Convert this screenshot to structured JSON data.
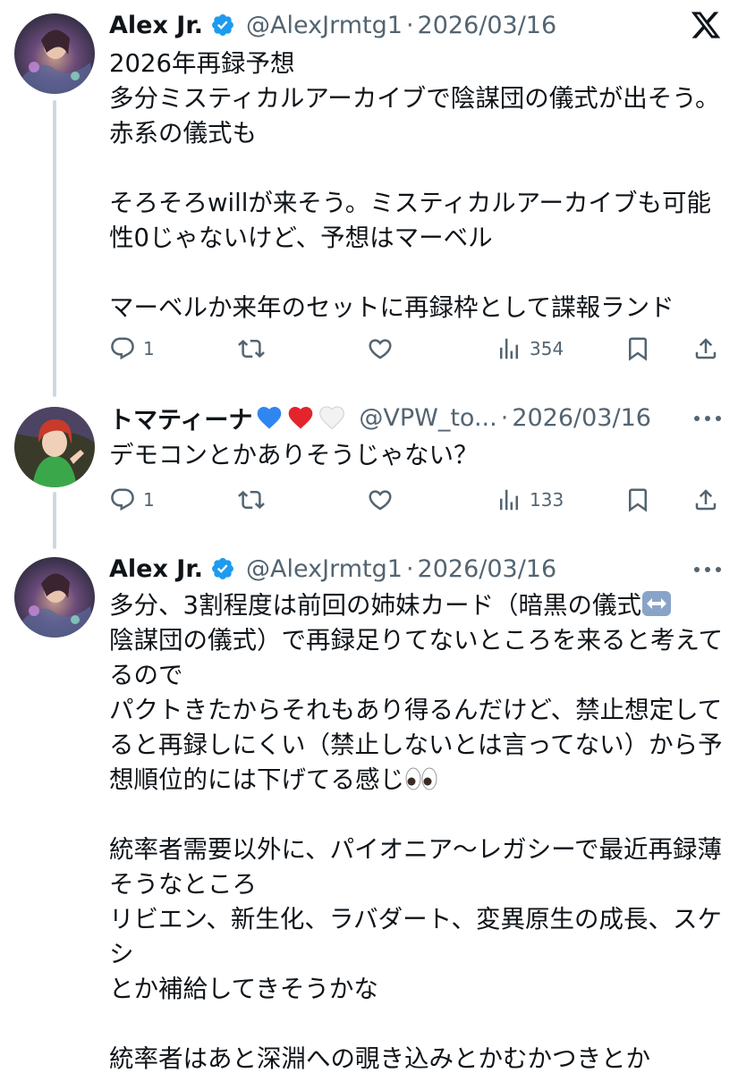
{
  "brand": {
    "logo_icon": "x-logo-icon"
  },
  "colors": {
    "verified": "#1d9bf0",
    "muted": "#536471",
    "thread_line": "#cfd9de",
    "text": "#0f1419"
  },
  "tweets": [
    {
      "author": {
        "name": "Alex Jr.",
        "handle": "@AlexJrmtg1",
        "verified": true
      },
      "date": "2026/03/16",
      "separator": "·",
      "text": "2026年再録予想\n多分ミスティカルアーカイブで陰謀団の儀式が出そう。赤系の儀式も\n\nそろそろwillが来そう。ミスティカルアーカイブも可能性0じゃないけど、予想はマーベル\n\nマーベルか来年のセットに再録枠として諜報ランド",
      "stats": {
        "replies": "1",
        "reposts": "",
        "likes": "",
        "views": "354"
      }
    },
    {
      "author": {
        "name": "トマティーナ",
        "name_emojis": [
          "blue-heart",
          "red-heart",
          "white-heart"
        ],
        "handle": "@VPW_to...",
        "verified": false
      },
      "date": "2026/03/16",
      "separator": "·",
      "text": "デモコンとかありそうじゃない？",
      "stats": {
        "replies": "1",
        "reposts": "",
        "likes": "",
        "views": "133"
      }
    },
    {
      "author": {
        "name": "Alex Jr.",
        "handle": "@AlexJrmtg1",
        "verified": true
      },
      "date": "2026/03/16",
      "separator": "·",
      "text_a": "多分、3割程度は前回の姉妹カード（暗黒の儀式",
      "text_b": "陰謀団の儀式）で再録足りてないところを来ると考えてるので\nパクトきたからそれもあり得るんだけど、禁止想定してると再録しにくい（禁止しないとは言ってない）から予想順位的には下げてる感じ",
      "text_c": "\n\n統率者需要以外に、パイオニア〜レガシーで最近再録薄そうなところ\nリビエン、新生化、ラバダート、変異原生の成長、スケシ\nとか補給してきそうかな\n\n統率者はあと深淵への覗き込みとかむかつきとか"
    }
  ]
}
